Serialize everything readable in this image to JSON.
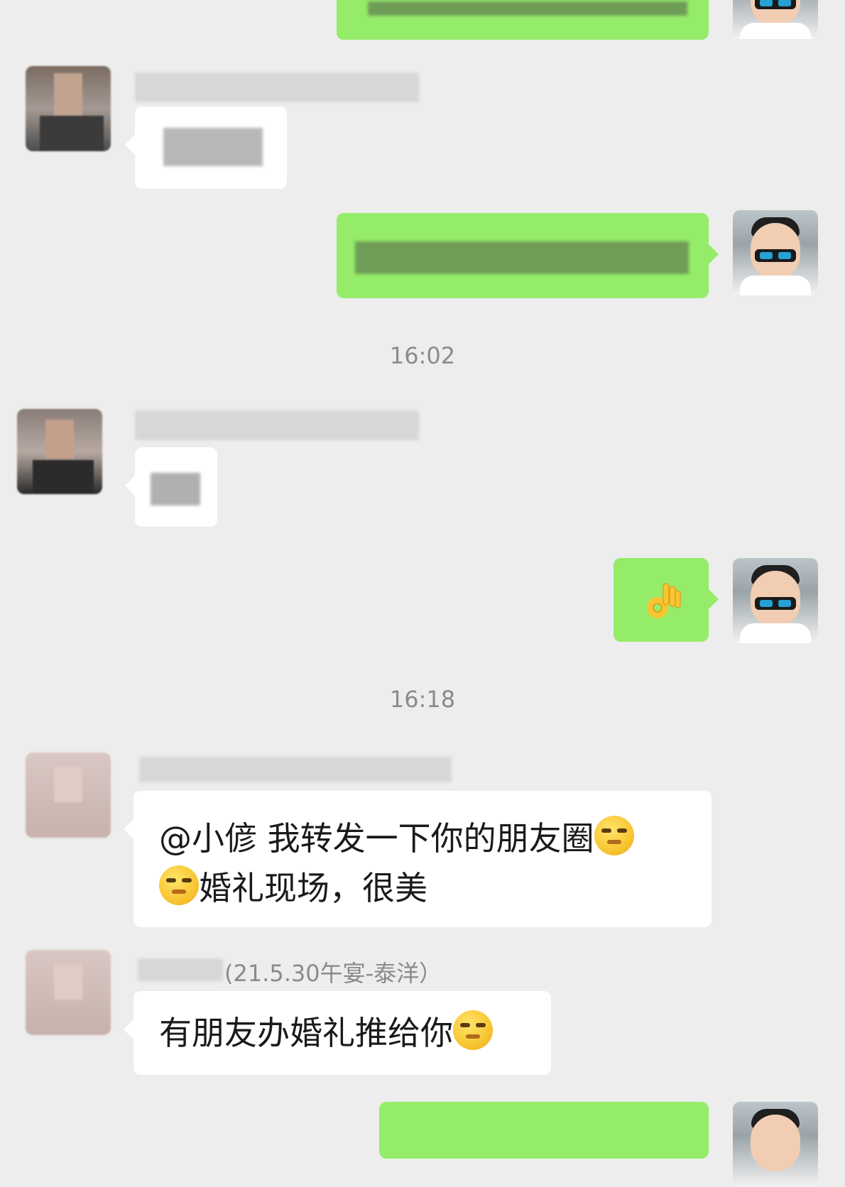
{
  "timestamps": [
    "16:02",
    "16:18"
  ],
  "messages": {
    "m1_text": "@小偐  我转发一下你的朋友圈",
    "m1_text2": "婚礼现场，很美",
    "m2_sender_suffix": "(21.5.30午宴-泰洋）",
    "m2_text": "有朋友办婚礼推给你"
  },
  "icons": {
    "emoji_smirk": "smirk-emoji",
    "emoji_ok": "ok-hand-emoji"
  },
  "colors": {
    "background": "#ededed",
    "self_bubble": "#95ec69",
    "other_bubble": "#ffffff",
    "timestamp": "#8b8b8b"
  }
}
